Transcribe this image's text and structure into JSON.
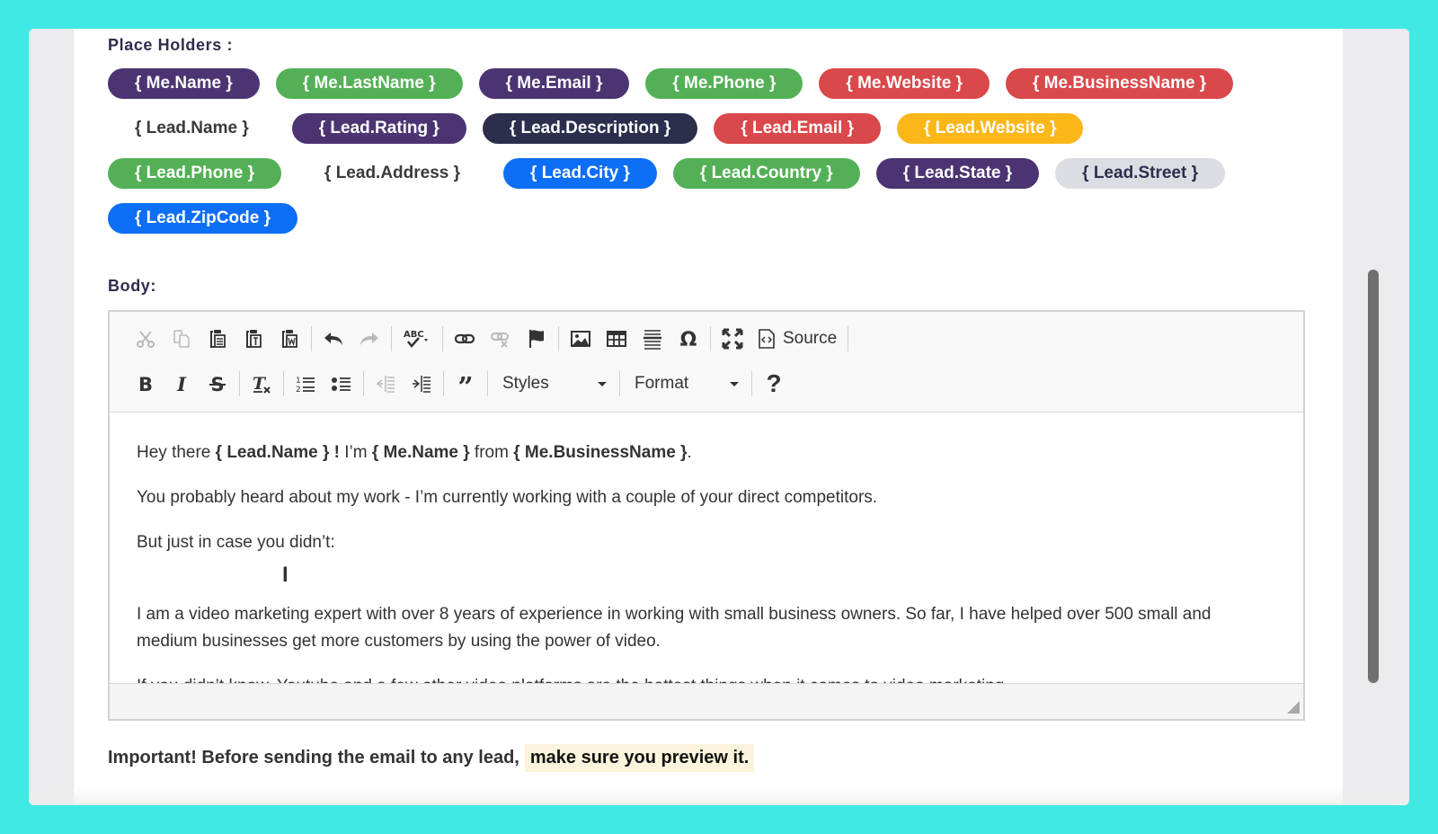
{
  "placeholders": {
    "label": "Place Holders :",
    "rows": [
      [
        {
          "text": "{ Me.Name }",
          "color": "#4c3472",
          "style": "filled"
        },
        {
          "text": "{ Me.LastName }",
          "color": "#53b056",
          "style": "filled"
        },
        {
          "text": "{ Me.Email }",
          "color": "#4c3472",
          "style": "filled"
        },
        {
          "text": "{ Me.Phone }",
          "color": "#53b056",
          "style": "filled"
        },
        {
          "text": "{ Me.Website }",
          "color": "#d9484a",
          "style": "filled"
        },
        {
          "text": "{ Me.BusinessName }",
          "color": "#d9484a",
          "style": "filled"
        }
      ],
      [
        {
          "text": "{ Lead.Name }",
          "color": "transparent",
          "style": "plain"
        },
        {
          "text": "{ Lead.Rating }",
          "color": "#4c3472",
          "style": "filled"
        },
        {
          "text": "{ Lead.Description }",
          "color": "#2c2e4c",
          "style": "filled"
        },
        {
          "text": "{ Lead.Email }",
          "color": "#d9484a",
          "style": "filled"
        },
        {
          "text": "{ Lead.Website }",
          "color": "#fbb718",
          "style": "filled"
        }
      ],
      [
        {
          "text": "{ Lead.Phone }",
          "color": "#53b056",
          "style": "filled"
        },
        {
          "text": "{ Lead.Address }",
          "color": "transparent",
          "style": "plain"
        },
        {
          "text": "{ Lead.City }",
          "color": "#0d6ef6",
          "style": "filled"
        },
        {
          "text": "{ Lead.Country }",
          "color": "#53b056",
          "style": "filled"
        },
        {
          "text": "{ Lead.State }",
          "color": "#4c3472",
          "style": "filled"
        },
        {
          "text": "{ Lead.Street }",
          "color": "#dcdde3",
          "style": "light"
        }
      ],
      [
        {
          "text": "{ Lead.ZipCode }",
          "color": "#0d6ef6",
          "style": "filled"
        }
      ]
    ]
  },
  "body_label": "Body:",
  "toolbar": {
    "row1": [
      {
        "icon": "cut-icon",
        "disabled": true
      },
      {
        "icon": "copy-icon",
        "disabled": true
      },
      {
        "icon": "paste-icon",
        "disabled": false
      },
      {
        "icon": "paste-text-icon",
        "disabled": false
      },
      {
        "icon": "paste-word-icon",
        "disabled": false
      },
      {
        "sep": true
      },
      {
        "icon": "undo-icon",
        "disabled": false
      },
      {
        "icon": "redo-icon",
        "disabled": true
      },
      {
        "sep": true
      },
      {
        "icon": "spellcheck-icon",
        "disabled": false
      },
      {
        "sep": true
      },
      {
        "icon": "link-icon",
        "disabled": false
      },
      {
        "icon": "unlink-icon",
        "disabled": true
      },
      {
        "icon": "anchor-flag-icon",
        "disabled": false
      },
      {
        "sep": true
      },
      {
        "icon": "image-icon",
        "disabled": false
      },
      {
        "icon": "table-icon",
        "disabled": false
      },
      {
        "icon": "horizontal-line-icon",
        "disabled": false
      },
      {
        "icon": "special-char-omega-icon",
        "disabled": false
      },
      {
        "sep": true
      },
      {
        "icon": "maximize-icon",
        "disabled": false
      },
      {
        "sep": true
      }
    ],
    "source_label": "Source",
    "row2": [
      {
        "icon": "bold-icon",
        "disabled": false
      },
      {
        "icon": "italic-icon",
        "disabled": false
      },
      {
        "icon": "strikethrough-icon",
        "disabled": false
      },
      {
        "sep": true
      },
      {
        "icon": "remove-format-icon",
        "disabled": false
      },
      {
        "sep": true
      },
      {
        "icon": "numbered-list-icon",
        "disabled": false
      },
      {
        "icon": "bulleted-list-icon",
        "disabled": false
      },
      {
        "sep": true
      },
      {
        "icon": "outdent-icon",
        "disabled": true
      },
      {
        "icon": "indent-icon",
        "disabled": false
      },
      {
        "sep": true
      },
      {
        "icon": "blockquote-icon",
        "disabled": false
      },
      {
        "sep": true
      }
    ],
    "styles_label": "Styles",
    "format_label": "Format",
    "help_label": "?"
  },
  "editor": {
    "line1": {
      "t1": "Hey there ",
      "b1": "{ Lead.Name } !",
      "t2": " I’m ",
      "b2": "{ Me.Name }",
      "t3": " from ",
      "b3": "{ Me.BusinessName }",
      "t4": "."
    },
    "p2": "You probably heard about my work - I’m currently working with a couple of your direct competitors.",
    "p3": "But just in case you didn’t:",
    "p4": "I am a video marketing expert with over 8 years of experience in working with small business owners. So far, I have helped over 500 small and medium businesses get more customers by using the power of video.",
    "p5": "If you didn’t know, Youtube and a few other video platforms are the hottest things when it comes to video marketing."
  },
  "notice": {
    "text": "Important! Before sending the email to any lead,",
    "highlight": "make sure you preview it."
  }
}
